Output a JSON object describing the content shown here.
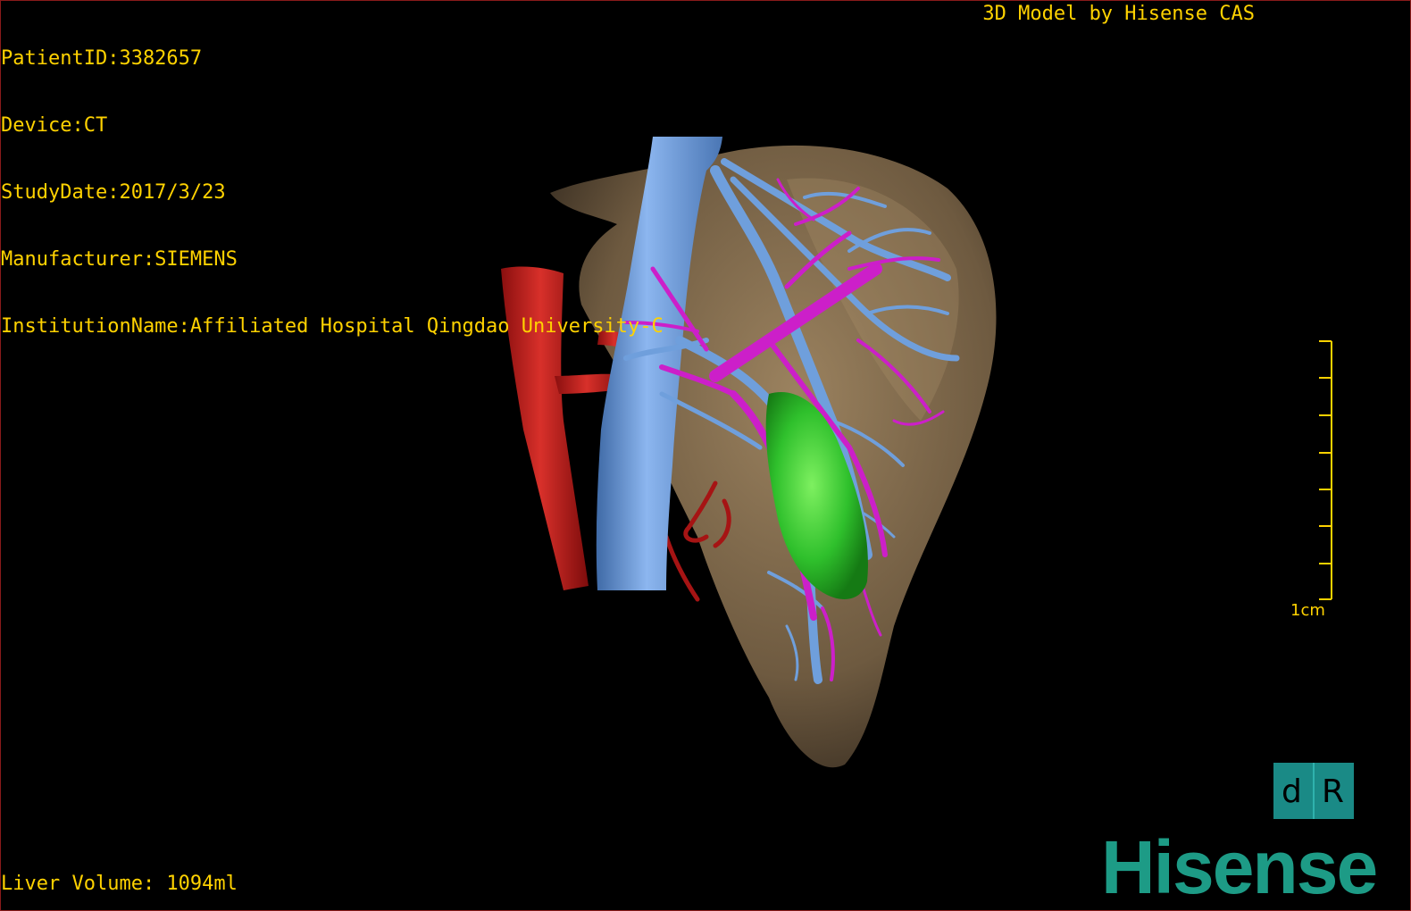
{
  "header": {
    "patient_id": "PatientID:3382657",
    "device": "Device:CT",
    "study_date": "StudyDate:2017/3/23",
    "manufacturer": "Manufacturer:SIEMENS",
    "institution": "InstitutionName:Affiliated Hospital Qingdao University-C",
    "model_credit": "3D Model by Hisense CAS"
  },
  "footer": {
    "liver_volume": "Liver Volume: 1094ml"
  },
  "scale_bar": {
    "label": "1cm"
  },
  "orientation": {
    "left_glyph": "d",
    "right_glyph": "R"
  },
  "logo": {
    "text": "Hisense"
  },
  "colors": {
    "overlay_text": "#ffd200",
    "liver": "#7a6448",
    "ivc_vein": "#6f9fdc",
    "aorta_artery": "#c01818",
    "portal_vein": "#cc1fc9",
    "tumor": "#2fc02c",
    "brand": "#1d9b86"
  }
}
